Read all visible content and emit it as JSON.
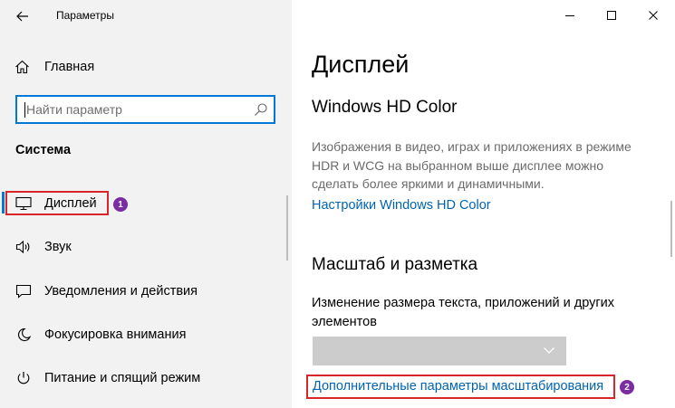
{
  "window": {
    "title": "Параметры"
  },
  "sidebar": {
    "home_label": "Главная",
    "search": {
      "placeholder": "Найти параметр",
      "value": ""
    },
    "section_title": "Система",
    "items": [
      {
        "label": "Дисплей",
        "icon": "monitor-icon",
        "active": true
      },
      {
        "label": "Звук",
        "icon": "speaker-icon"
      },
      {
        "label": "Уведомления и действия",
        "icon": "notification-icon"
      },
      {
        "label": "Фокусировка внимания",
        "icon": "moon-icon"
      },
      {
        "label": "Питание и спящий режим",
        "icon": "power-icon"
      }
    ]
  },
  "main": {
    "title": "Дисплей",
    "hdr": {
      "heading": "Windows HD Color",
      "description": "Изображения в видео, играх и приложениях в режиме HDR и WCG на выбранном выше дисплее можно сделать более яркими и динамичными.",
      "link": "Настройки Windows HD Color"
    },
    "scale": {
      "heading": "Масштаб и разметка",
      "label": "Изменение размера текста, приложений и других элементов",
      "dropdown_value": "",
      "advanced_link": "Дополнительные параметры масштабирования"
    }
  },
  "annotations": {
    "badge_1": "1",
    "badge_2": "2",
    "badge_color": "#7b2ca3",
    "highlight_color": "#d9242a"
  },
  "colors": {
    "accent": "#0078d7",
    "link": "#0063b1",
    "sidebar_bg": "#f2f2f2"
  }
}
